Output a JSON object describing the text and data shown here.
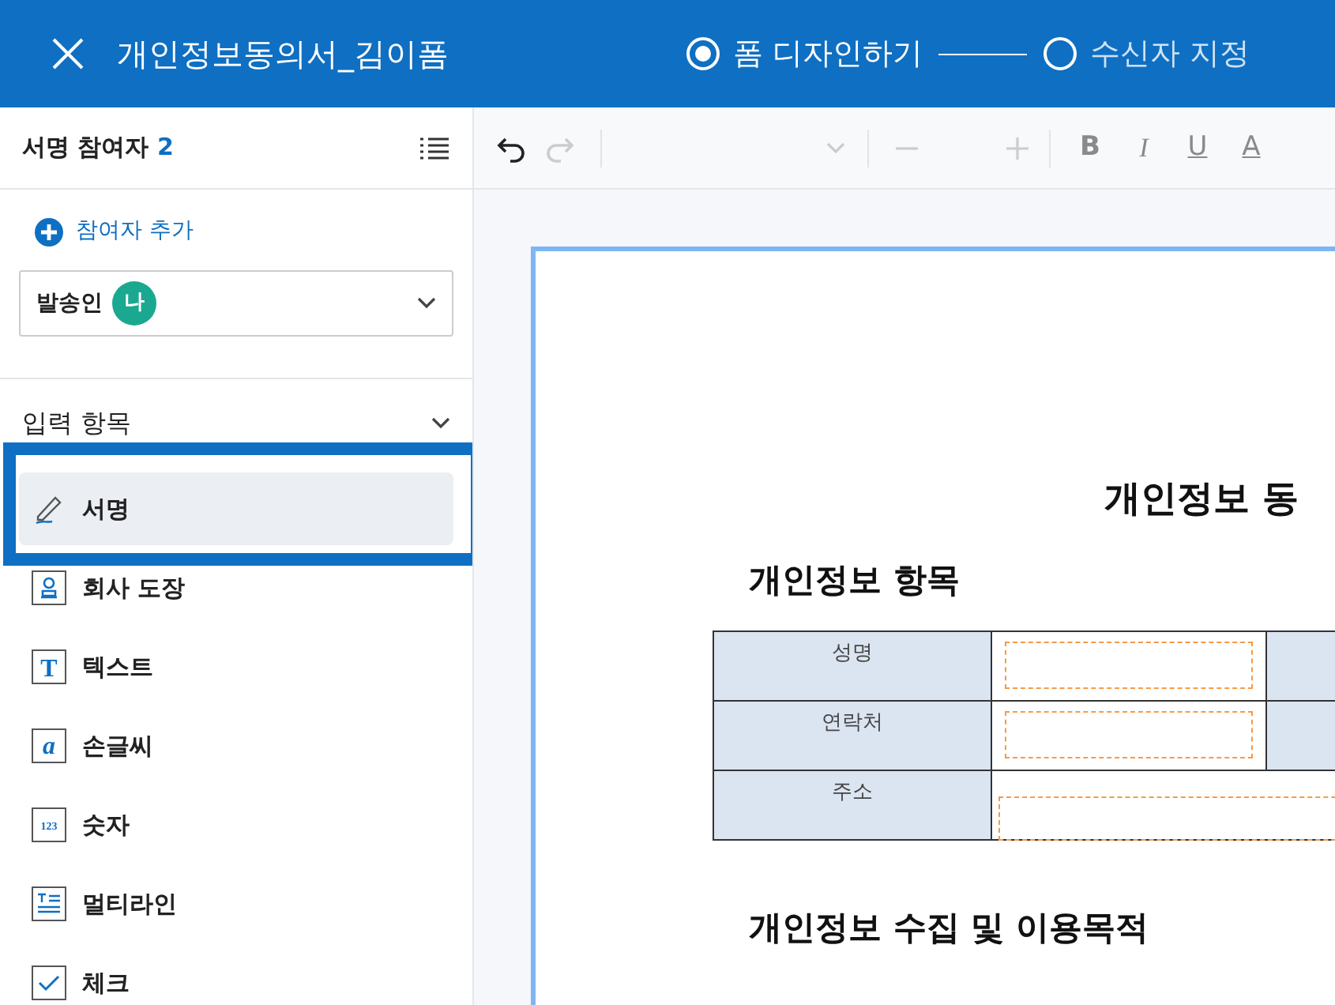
{
  "header": {
    "title": "개인정보동의서_김이폼",
    "steps": [
      {
        "label": "폼 디자인하기",
        "selected": true
      },
      {
        "label": "수신자 지정",
        "selected": false
      }
    ]
  },
  "sidebar": {
    "title": "서명 참여자",
    "count": "2",
    "add_label": "참여자 추가",
    "participant": {
      "label": "발송인",
      "badge": "나"
    },
    "section": {
      "title": "입력 항목",
      "expanded": true
    },
    "items": [
      {
        "kind": "signature",
        "label": "서명",
        "selected": true
      },
      {
        "kind": "stamp",
        "label": "회사 도장",
        "selected": false
      },
      {
        "kind": "text",
        "label": "텍스트",
        "selected": false,
        "icon": "T"
      },
      {
        "kind": "handwriting",
        "label": "손글씨",
        "selected": false,
        "icon": "a"
      },
      {
        "kind": "number",
        "label": "숫자",
        "selected": false,
        "icon": "123"
      },
      {
        "kind": "multiline",
        "label": "멀티라인",
        "selected": false
      },
      {
        "kind": "check",
        "label": "체크",
        "selected": false
      }
    ]
  },
  "toolbar": {
    "format_buttons": [
      "B",
      "I",
      "U",
      "A"
    ]
  },
  "document": {
    "title": "개인정보 동",
    "section_1": "개인정보 항목",
    "rows": [
      {
        "label": "성명",
        "kind": "half"
      },
      {
        "label": "연락처",
        "kind": "half"
      },
      {
        "label": "주소",
        "kind": "wide"
      }
    ],
    "section_2": "개인정보 수집 및 이용목적"
  }
}
